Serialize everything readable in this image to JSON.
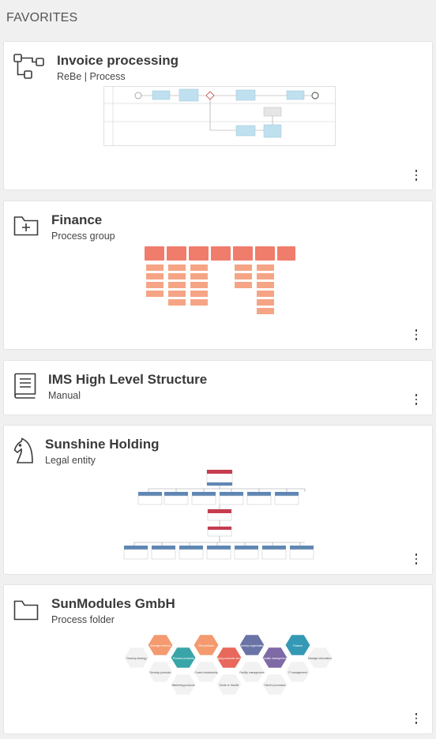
{
  "section": {
    "title": "FAVORITES"
  },
  "favorites": [
    {
      "title": "Invoice processing",
      "subtitle": "ReBe | Process",
      "icon": "process-flow-icon"
    },
    {
      "title": "Finance",
      "subtitle": "Process group",
      "icon": "folder-plus-icon"
    },
    {
      "title": "IMS High Level Structure",
      "subtitle": "Manual",
      "icon": "book-icon"
    },
    {
      "title": "Sunshine Holding",
      "subtitle": "Legal entity",
      "icon": "chess-knight-icon"
    },
    {
      "title": "SunModules GmbH",
      "subtitle": "Process folder",
      "icon": "folder-icon"
    }
  ],
  "sunmodules_map": {
    "cells": [
      "Develop strategy",
      "Manage external",
      "Develop products",
      "Produce products",
      "Marketing products",
      "Sell products",
      "Control relationship",
      "Managing customer accounts",
      "Guide or Handle",
      "Develop organisation",
      "Facility management",
      "Quality management",
      "Client's processes",
      "Finance",
      "IT management",
      "Manage information"
    ]
  },
  "colors": {
    "process_box": "#bfe0ef",
    "finance_head": "#f07c6c",
    "finance_item": "#f5a585",
    "org_head": "#c53d4f",
    "org_blue": "#5f87b4"
  }
}
